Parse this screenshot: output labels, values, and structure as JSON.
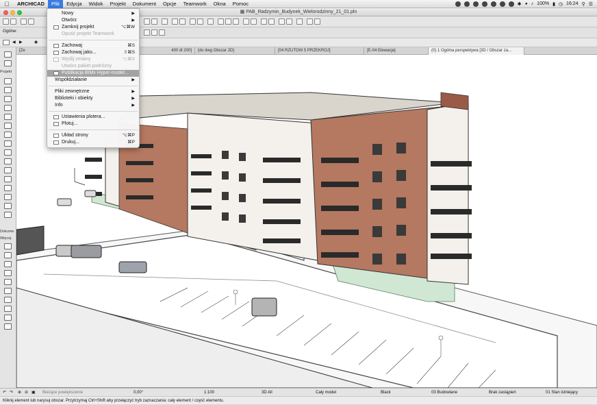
{
  "menubar": {
    "app": "ARCHICAD",
    "items": [
      "Plik",
      "Edycja",
      "Widok",
      "Projekt",
      "Dokument",
      "Opcje",
      "Teamwork",
      "Okna",
      "Pomoc"
    ],
    "active": "Plik",
    "battery": "100%",
    "clock": "16:24"
  },
  "window": {
    "title": "PAB_Radzymin_Budynek_Wielorodzinny_21_01.pln"
  },
  "infobox": {
    "label": "Ogólne:"
  },
  "tabs": [
    "[Ze",
    "400 dl 200]",
    "[do dwg Obszar 2D]",
    "[04 RZUTOW 5 PRZEKROJ]",
    "[E-04 Elewacja]",
    "(0) 1 Ogólna perspektywa [3D / Obszar za..."
  ],
  "toolbox": {
    "label_project": "Projekt",
    "label_document": "Dokume",
    "label_more": "Więcej"
  },
  "file_menu": {
    "items": [
      {
        "label": "Nowy",
        "shortcut": "",
        "submenu": true,
        "disabled": false
      },
      {
        "label": "Otwórz",
        "shortcut": "",
        "submenu": true,
        "disabled": false
      },
      {
        "label": "Zamknij projekt",
        "shortcut": "⌥⌘W",
        "submenu": false,
        "disabled": false
      },
      {
        "label": "Opuść projekt Teamwork",
        "shortcut": "",
        "submenu": false,
        "disabled": true
      },
      {
        "label": "Zachowaj",
        "shortcut": "⌘S",
        "submenu": false,
        "disabled": false
      },
      {
        "label": "Zachowaj jako...",
        "shortcut": "⇧⌘S",
        "submenu": false,
        "disabled": false
      },
      {
        "label": "Wyślij zmiany",
        "shortcut": "⌥⌘S",
        "submenu": false,
        "disabled": true
      },
      {
        "label": "Utwórz pakiet podróżny",
        "shortcut": "",
        "submenu": false,
        "disabled": true
      },
      {
        "label": "Publikacja BIMx Hyper-model...",
        "shortcut": "",
        "submenu": false,
        "disabled": false,
        "highlighted": true
      },
      {
        "label": "Współdziałanie",
        "shortcut": "",
        "submenu": true,
        "disabled": false
      },
      {
        "label": "Pliki zewnętrzne",
        "shortcut": "",
        "submenu": true,
        "disabled": false
      },
      {
        "label": "Biblioteki i obiekty",
        "shortcut": "",
        "submenu": true,
        "disabled": false
      },
      {
        "label": "Info",
        "shortcut": "",
        "submenu": true,
        "disabled": false
      },
      {
        "label": "Ustawienia plotera...",
        "shortcut": "",
        "submenu": false,
        "disabled": false
      },
      {
        "label": "Plotuj...",
        "shortcut": "",
        "submenu": false,
        "disabled": false
      },
      {
        "label": "Układ strony",
        "shortcut": "⌥⌘P",
        "submenu": false,
        "disabled": false
      },
      {
        "label": "Drukuj...",
        "shortcut": "⌘P",
        "submenu": false,
        "disabled": false
      }
    ]
  },
  "statusbar": {
    "view_label": "Bieżące powiększenie",
    "angle": "0,00°",
    "scale": "1:100",
    "layer": "3D All",
    "model": "Cały model",
    "pen": "Black",
    "structure": "03 Budowlane",
    "override": "Brak zastąpień",
    "renovation": "01 Stan istniejący"
  },
  "hint": "Kliknij element lub narysuj obszar. Przytrzymaj Ctrl+Shift aby przełączyć tryb zaznaczania: cały element / część elementu.",
  "colors": {
    "accent": "#3b7ce4",
    "facade_brick": "#b57860",
    "facade_white": "#f4f1ec",
    "balcony": "#2a2a2a",
    "menu_highlight": "#a3a3a3"
  }
}
